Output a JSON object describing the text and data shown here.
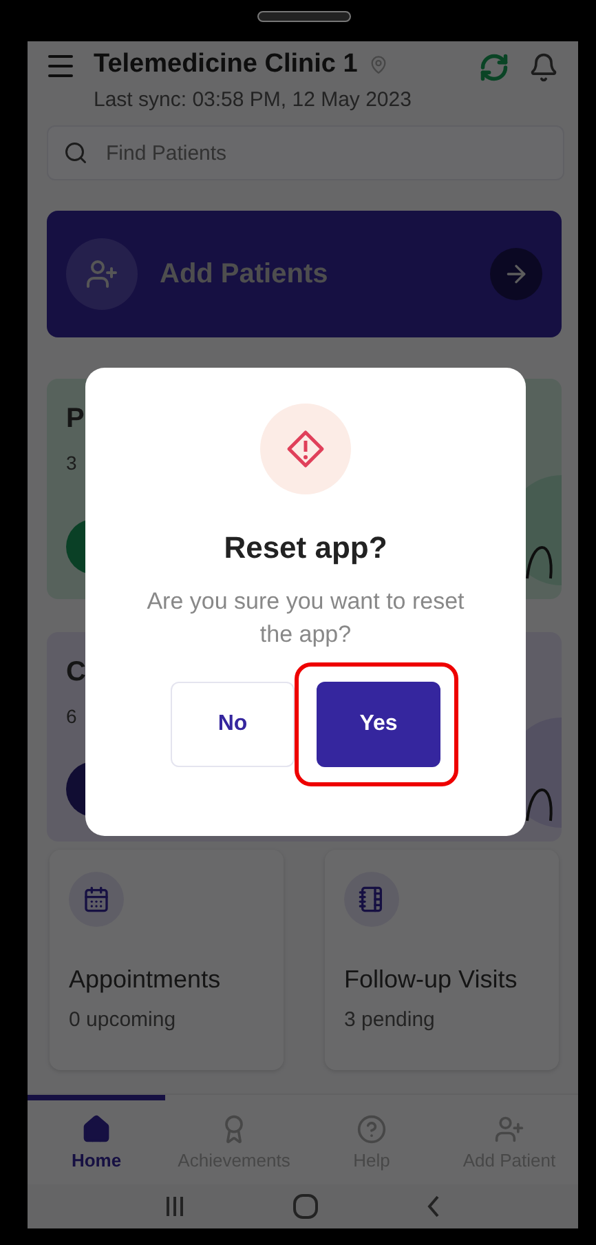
{
  "header": {
    "title": "Telemedicine Clinic 1",
    "last_sync": "Last sync: 03:58 PM, 12 May 2023"
  },
  "search": {
    "placeholder": "Find Patients"
  },
  "add_patients": {
    "label": "Add Patients"
  },
  "summary_cards": [
    {
      "title": "P",
      "subtitle": "3"
    },
    {
      "title": "C",
      "subtitle": "6"
    }
  ],
  "stat_cards": [
    {
      "kind": "calendar",
      "title": "Appointments",
      "subtitle": "0 upcoming"
    },
    {
      "kind": "list",
      "title": "Follow-up Visits",
      "subtitle": "3 pending"
    }
  ],
  "nav": [
    {
      "kind": "home",
      "label": "Home",
      "selected": true
    },
    {
      "kind": "award",
      "label": "Achievements",
      "selected": false
    },
    {
      "kind": "help",
      "label": "Help",
      "selected": false
    },
    {
      "kind": "add",
      "label": "Add Patient",
      "selected": false
    }
  ],
  "dialog": {
    "title": "Reset app?",
    "message": "Are you sure you want to reset the app?",
    "buttons": [
      {
        "kind": "secondary",
        "label": "No",
        "highlighted": false
      },
      {
        "kind": "primary",
        "label": "Yes",
        "highlighted": true
      }
    ]
  }
}
